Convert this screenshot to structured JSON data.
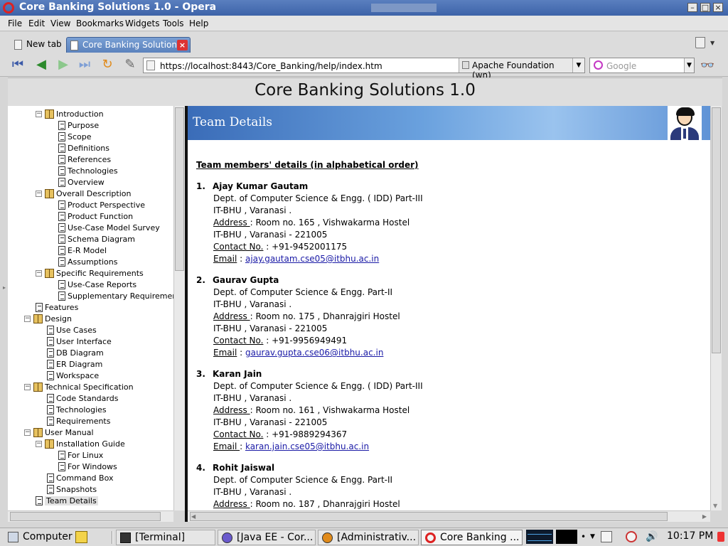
{
  "window": {
    "title": "Core Banking Solutions 1.0 - Opera"
  },
  "menu": [
    {
      "label": "File"
    },
    {
      "label": "Edit"
    },
    {
      "label": "View"
    },
    {
      "label": "Bookmarks"
    },
    {
      "label": "Widgets"
    },
    {
      "label": "Tools"
    },
    {
      "label": "Help"
    }
  ],
  "tabs": [
    {
      "label": "New tab"
    },
    {
      "label": "Core Banking Solution..."
    }
  ],
  "address": {
    "url": "https://localhost:8443/Core_Banking/help/index.htm",
    "site_identity": "Apache Foundation (wn)",
    "search_placeholder": "Google"
  },
  "page": {
    "title": "Core Banking Solutions 1.0",
    "banner_title": "Team Details",
    "heading": "Team members' details (in alphabetical order)"
  },
  "tree": [
    {
      "label": "Introduction",
      "type": "book",
      "depth": 2
    },
    {
      "label": "Purpose",
      "type": "page",
      "depth": 3
    },
    {
      "label": "Scope",
      "type": "page",
      "depth": 3
    },
    {
      "label": "Definitions",
      "type": "page",
      "depth": 3
    },
    {
      "label": "References",
      "type": "page",
      "depth": 3
    },
    {
      "label": "Technologies",
      "type": "page",
      "depth": 3
    },
    {
      "label": "Overview",
      "type": "page",
      "depth": 3
    },
    {
      "label": "Overall Description",
      "type": "book",
      "depth": 2
    },
    {
      "label": "Product Perspective",
      "type": "page",
      "depth": 3
    },
    {
      "label": "Product Function",
      "type": "page",
      "depth": 3
    },
    {
      "label": "Use-Case Model Survey",
      "type": "page",
      "depth": 3
    },
    {
      "label": "Schema Diagram",
      "type": "page",
      "depth": 3
    },
    {
      "label": "E-R Model",
      "type": "page",
      "depth": 3
    },
    {
      "label": "Assumptions",
      "type": "page",
      "depth": 3
    },
    {
      "label": "Specific Requirements",
      "type": "book",
      "depth": 2
    },
    {
      "label": "Use-Case Reports",
      "type": "page",
      "depth": 3
    },
    {
      "label": "Supplementary Requirements",
      "type": "page",
      "depth": 3
    },
    {
      "label": "Features",
      "type": "page",
      "depth": 1
    },
    {
      "label": "Design",
      "type": "book",
      "depth": 1
    },
    {
      "label": "Use Cases",
      "type": "page",
      "depth": 2
    },
    {
      "label": "User Interface",
      "type": "page",
      "depth": 2
    },
    {
      "label": "DB Diagram",
      "type": "page",
      "depth": 2
    },
    {
      "label": "ER Diagram",
      "type": "page",
      "depth": 2
    },
    {
      "label": "Workspace",
      "type": "page",
      "depth": 2
    },
    {
      "label": "Technical Specification",
      "type": "book",
      "depth": 1
    },
    {
      "label": "Code Standards",
      "type": "page",
      "depth": 2
    },
    {
      "label": "Technologies",
      "type": "page",
      "depth": 2
    },
    {
      "label": "Requirements",
      "type": "page",
      "depth": 2
    },
    {
      "label": "User Manual",
      "type": "book",
      "depth": 1
    },
    {
      "label": "Installation Guide",
      "type": "book",
      "depth": 2
    },
    {
      "label": "For Linux",
      "type": "page",
      "depth": 3
    },
    {
      "label": "For Windows",
      "type": "page",
      "depth": 3
    },
    {
      "label": "Command Box",
      "type": "page",
      "depth": 2
    },
    {
      "label": "Snapshots",
      "type": "page",
      "depth": 2
    },
    {
      "label": "Team Details",
      "type": "page",
      "depth": 1,
      "selected": true
    }
  ],
  "members": [
    {
      "num": "1.",
      "name": "Ajay Kumar Gautam",
      "dept": "Dept. of Computer Science & Engg. ( IDD) Part-III",
      "inst": "IT-BHU , Varanasi .",
      "address_label": "Address ",
      "address": ": Room no. 165 , Vishwakarma Hostel",
      "city": "IT-BHU , Varanasi - 221005",
      "contact_label": "Contact No.",
      "contact": " : +91-9452001175",
      "email_label": "Email",
      "email_sep": " : ",
      "email": "ajay.gautam.cse05@itbhu.ac.in"
    },
    {
      "num": "2.",
      "name": "Gaurav Gupta",
      "dept": "Dept. of Computer Science & Engg.  Part-II",
      "inst": "IT-BHU , Varanasi .",
      "address_label": "Address ",
      "address": ": Room no. 175 , Dhanrajgiri Hostel",
      "city": "IT-BHU , Varanasi - 221005",
      "contact_label": "Contact No.",
      "contact": " : +91-9956949491",
      "email_label": "Email",
      "email_sep": " : ",
      "email": "gaurav.gupta.cse06@itbhu.ac.in"
    },
    {
      "num": "3.",
      "name": "Karan Jain",
      "dept": "Dept. of Computer Science & Engg. ( IDD) Part-III",
      "inst": "IT-BHU , Varanasi .",
      "address_label": "Address ",
      "address": ": Room no. 161 , Vishwakarma Hostel",
      "city": "IT-BHU , Varanasi - 221005",
      "contact_label": "Contact No.",
      "contact": " : +91-9889294367",
      "email_label": "Email ",
      "email_sep": ": ",
      "email": "karan.jain.cse05@itbhu.ac.in"
    },
    {
      "num": "4.",
      "name": "Rohit Jaiswal",
      "dept": "Dept. of Computer Science & Engg.  Part-II",
      "inst": "IT-BHU , Varanasi .",
      "address_label": "Address ",
      "address": ": Room no. 187 , Dhanrajgiri Hostel"
    }
  ],
  "taskbar": {
    "items": [
      {
        "label": "Computer"
      },
      {
        "label": "[Terminal]"
      },
      {
        "label": "[Java EE - Cor..."
      },
      {
        "label": "[Administrativ..."
      },
      {
        "label": "Core Banking ..."
      }
    ],
    "clock": "10:17 PM"
  },
  "colors": {
    "titlebar": "#3d63a8",
    "banner": "#6aa1de",
    "link": "#1a1aa6"
  }
}
